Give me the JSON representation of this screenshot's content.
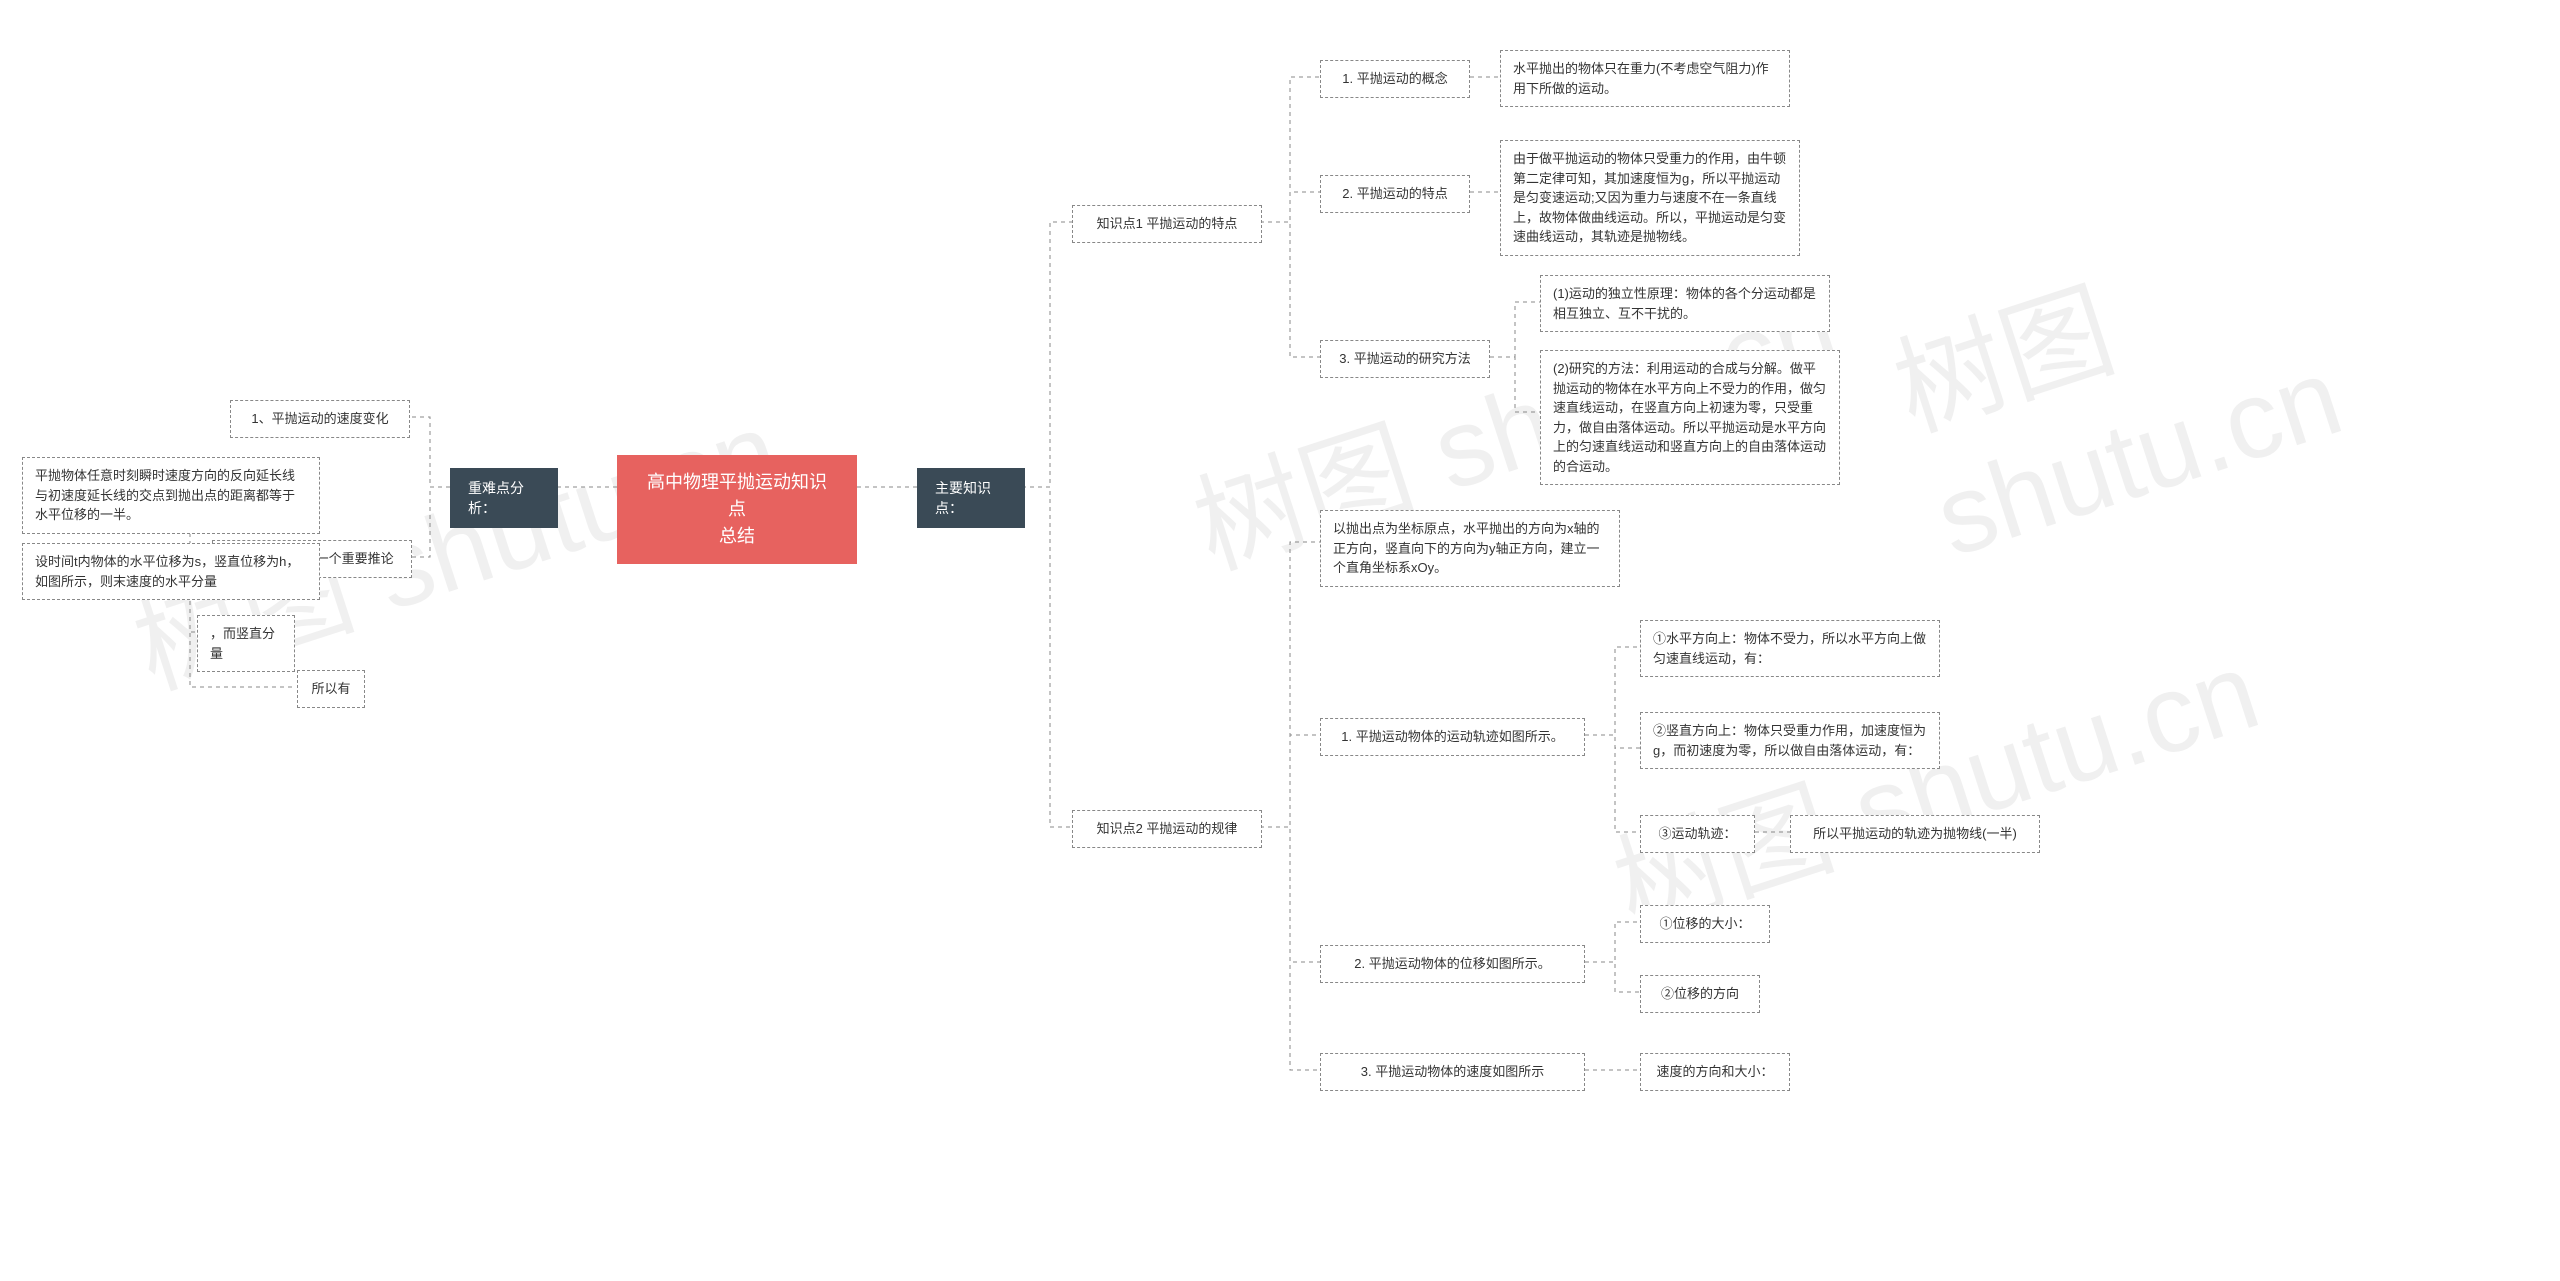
{
  "watermark": "树图 shutu.cn",
  "root": "高中物理平抛运动知识点\n总结",
  "left": {
    "cat": "重难点分析：",
    "n1": "1、平抛运动的速度变化",
    "n2": "2、平抛运动的一个重要推论",
    "n2a": "平抛物体任意时刻瞬时速度方向的反向延长线与初速度延长线的交点到抛出点的距离都等于水平位移的一半。",
    "n2b": "设时间t内物体的水平位移为s，竖直位移为h，如图所示，则末速度的水平分量",
    "n2c": "，而竖直分量",
    "n2d": "所以有"
  },
  "right": {
    "cat": "主要知识点：",
    "k1": {
      "title": "知识点1 平抛运动的特点",
      "a": "1. 平抛运动的概念",
      "a1": "水平抛出的物体只在重力(不考虑空气阻力)作用下所做的运动。",
      "b": "2. 平抛运动的特点",
      "b1": "由于做平抛运动的物体只受重力的作用，由牛顿第二定律可知，其加速度恒为g，所以平抛运动是匀变速运动;又因为重力与速度不在一条直线上，故物体做曲线运动。所以，平抛运动是匀变速曲线运动，其轨迹是抛物线。",
      "c": "3. 平抛运动的研究方法",
      "c1": "(1)运动的独立性原理：物体的各个分运动都是相互独立、互不干扰的。",
      "c2": "(2)研究的方法：利用运动的合成与分解。做平抛运动的物体在水平方向上不受力的作用，做匀速直线运动，在竖直方向上初速为零，只受重力，做自由落体运动。所以平抛运动是水平方向上的匀速直线运动和竖直方向上的自由落体运动的合运动。"
    },
    "k2": {
      "title": "知识点2 平抛运动的规律",
      "intro": "以抛出点为坐标原点，水平抛出的方向为x轴的正方向，竖直向下的方向为y轴正方向，建立一个直角坐标系xOy。",
      "a": "1. 平抛运动物体的运动轨迹如图所示。",
      "a1": "①水平方向上：物体不受力，所以水平方向上做匀速直线运动，有：",
      "a2": "②竖直方向上：物体只受重力作用，加速度恒为g，而初速度为零，所以做自由落体运动，有：",
      "a3": "③运动轨迹：",
      "a3b": "所以平抛运动的轨迹为抛物线(一半)",
      "b": "2. 平抛运动物体的位移如图所示。",
      "b1": "①位移的大小：",
      "b2": "②位移的方向",
      "c": "3. 平抛运动物体的速度如图所示",
      "c1": "速度的方向和大小："
    }
  }
}
